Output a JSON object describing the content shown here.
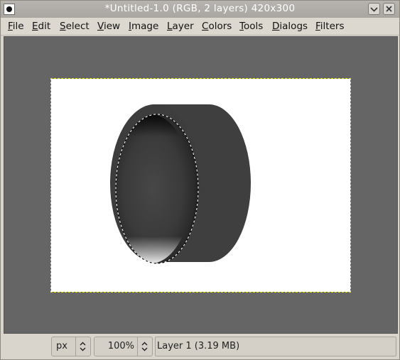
{
  "window": {
    "title": "*Untitled-1.0 (RGB, 2 layers) 420x300"
  },
  "menubar": {
    "items": [
      "File",
      "Edit",
      "Select",
      "View",
      "Image",
      "Layer",
      "Colors",
      "Tools",
      "Dialogs",
      "Filters"
    ]
  },
  "statusbar": {
    "unit": "px",
    "zoom": "100%",
    "message": "Layer 1 (3.19 MB)"
  },
  "colors": {
    "canvas_bg": "#656565",
    "image_bg": "#ffffff",
    "cylinder": "#3f3f3f",
    "selection_marching_ants": "#e6e600"
  },
  "icons": [
    "app-icon",
    "minimize-icon",
    "close-icon",
    "unit-spinner-icon",
    "zoom-spinner-icon"
  ]
}
